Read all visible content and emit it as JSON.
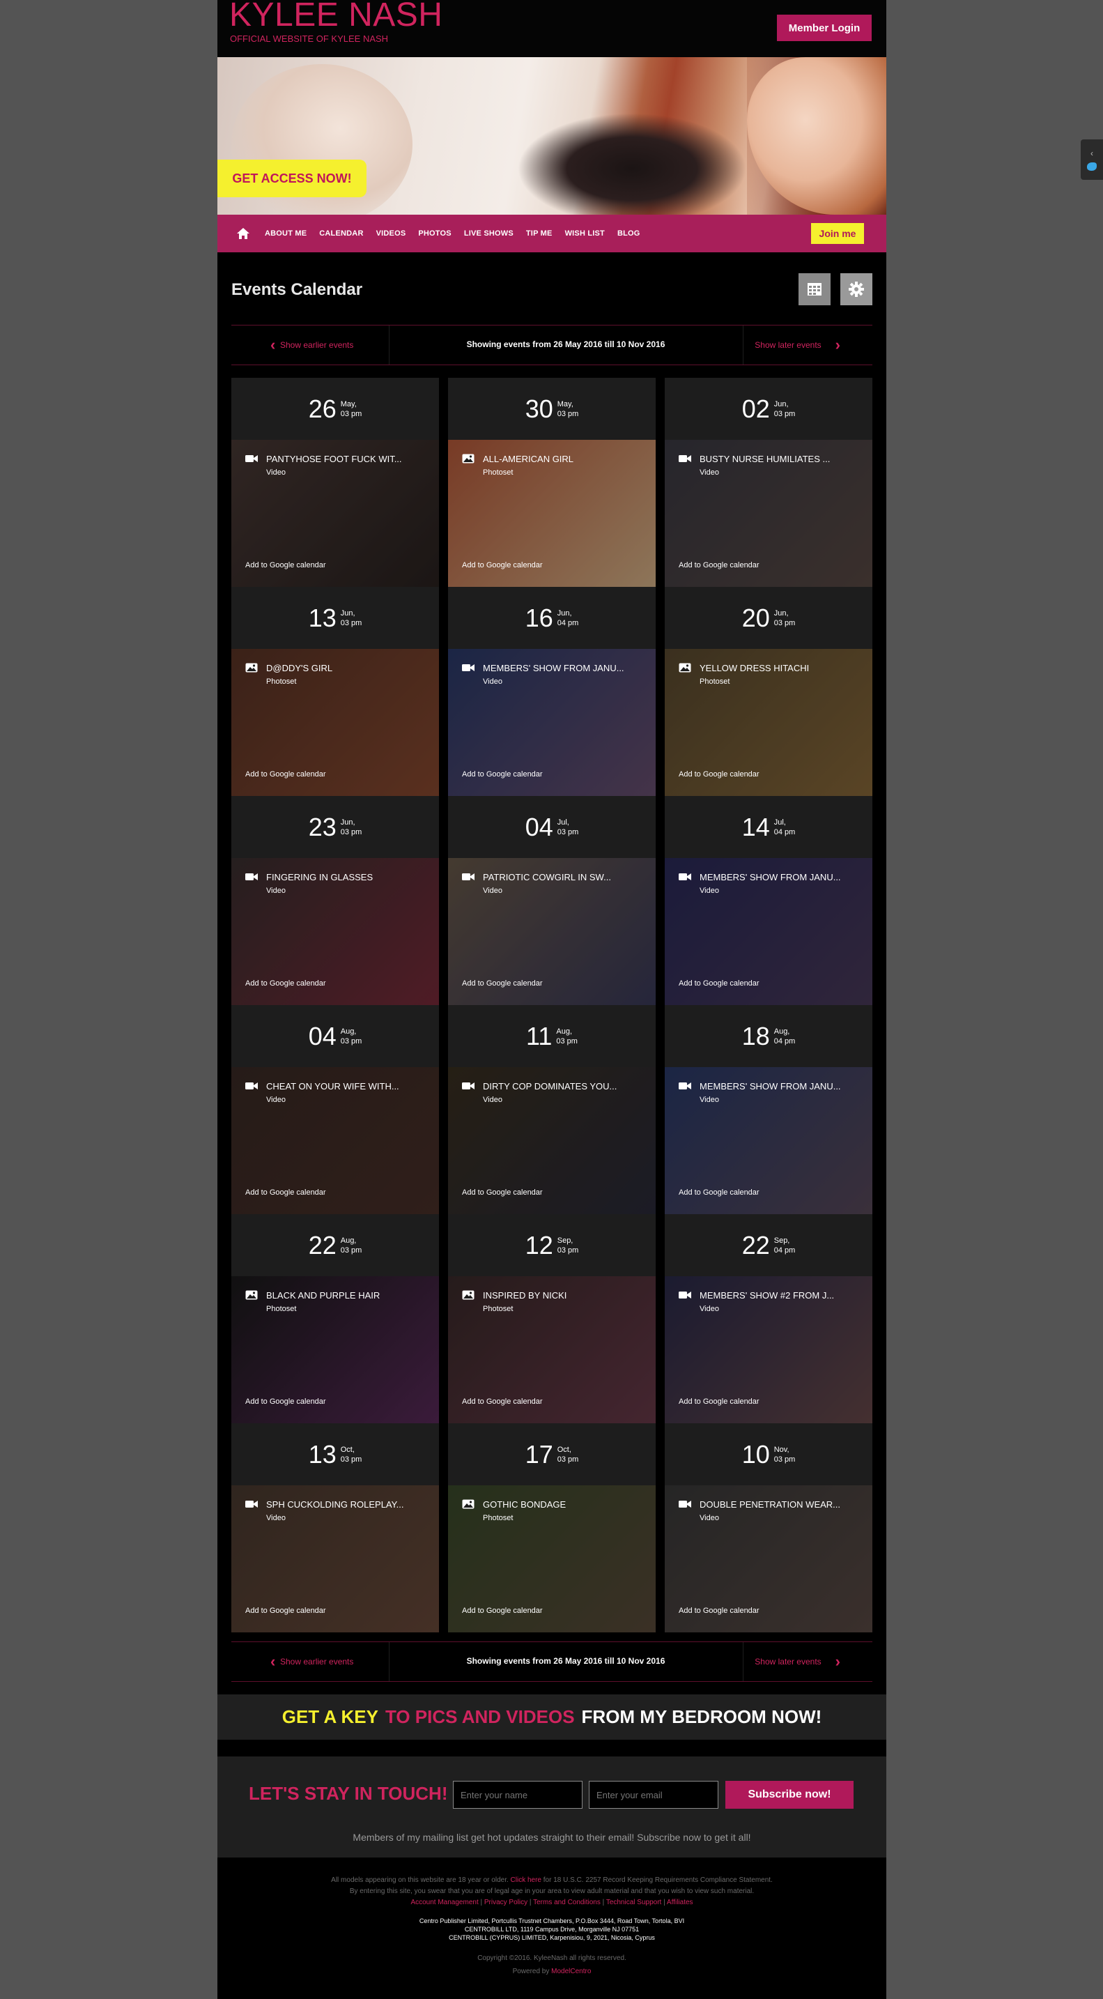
{
  "header": {
    "logo": "KYLEE NASH",
    "tagline": "OFFICIAL WEBSITE OF KYLEE NASH",
    "login_label": "Member Login"
  },
  "banner": {
    "cta_label": "GET ACCESS NOW!"
  },
  "nav": {
    "home_icon": "home-icon",
    "items": [
      "ABOUT ME",
      "CALENDAR",
      "VIDEOS",
      "PHOTOS",
      "LIVE SHOWS",
      "TIP ME",
      "WISH LIST",
      "BLOG"
    ],
    "join_label": "Join me"
  },
  "calendar": {
    "title": "Events Calendar",
    "view_icons": [
      "calendar-icon",
      "gear-icon"
    ],
    "prev_label": "Show earlier events",
    "next_label": "Show later events",
    "range_text": "Showing events from 26 May 2016 till 10 Nov 2016",
    "gcal_label": "Add to Google calendar",
    "events": [
      {
        "day": "26",
        "month": "May,",
        "time": "03 pm",
        "title": "PANTYHOSE FOOT FUCK WIT...",
        "kind": "Video",
        "icon": "video-icon",
        "colors": [
          "#4a3a36",
          "#2a2220"
        ]
      },
      {
        "day": "30",
        "month": "May,",
        "time": "03 pm",
        "title": "ALL-AMERICAN GIRL",
        "kind": "Photoset",
        "icon": "image-icon",
        "colors": [
          "#b85a3a",
          "#d9b58a"
        ]
      },
      {
        "day": "02",
        "month": "Jun,",
        "time": "03 pm",
        "title": "BUSTY NURSE HUMILIATES ...",
        "kind": "Video",
        "icon": "video-icon",
        "colors": [
          "#3b3a44",
          "#5a4a44"
        ]
      },
      {
        "day": "13",
        "month": "Jun,",
        "time": "03 pm",
        "title": "D@DDY'S GIRL",
        "kind": "Photoset",
        "icon": "image-icon",
        "colors": [
          "#5a3426",
          "#8a4a30"
        ]
      },
      {
        "day": "16",
        "month": "Jun,",
        "time": "04 pm",
        "title": "MEMBERS' SHOW FROM JANU...",
        "kind": "Video",
        "icon": "video-icon",
        "colors": [
          "#2a3a6a",
          "#6a5070"
        ]
      },
      {
        "day": "20",
        "month": "Jun,",
        "time": "03 pm",
        "title": "YELLOW DRESS HITACHI",
        "kind": "Photoset",
        "icon": "image-icon",
        "colors": [
          "#5a4a30",
          "#8a6a3a"
        ]
      },
      {
        "day": "23",
        "month": "Jun,",
        "time": "03 pm",
        "title": "FINGERING IN GLASSES",
        "kind": "Video",
        "icon": "video-icon",
        "colors": [
          "#3a3030",
          "#7a2a3a"
        ]
      },
      {
        "day": "04",
        "month": "Jul,",
        "time": "03 pm",
        "title": "PATRIOTIC COWGIRL IN SW...",
        "kind": "Video",
        "icon": "video-icon",
        "colors": [
          "#6a5a4a",
          "#3a3a5a"
        ]
      },
      {
        "day": "14",
        "month": "Jul,",
        "time": "04 pm",
        "title": "MEMBERS' SHOW FROM JANU...",
        "kind": "Video",
        "icon": "video-icon",
        "colors": [
          "#2a2a5a",
          "#4a3a5a"
        ]
      },
      {
        "day": "04",
        "month": "Aug,",
        "time": "03 pm",
        "title": "CHEAT ON YOUR WIFE WITH...",
        "kind": "Video",
        "icon": "video-icon",
        "colors": [
          "#3a2a26",
          "#4a3028"
        ]
      },
      {
        "day": "11",
        "month": "Aug,",
        "time": "03 pm",
        "title": "DIRTY COP DOMINATES YOU...",
        "kind": "Video",
        "icon": "video-icon",
        "colors": [
          "#3a3020",
          "#2a2a3a"
        ]
      },
      {
        "day": "18",
        "month": "Aug,",
        "time": "04 pm",
        "title": "MEMBERS' SHOW FROM JANU...",
        "kind": "Video",
        "icon": "video-icon",
        "colors": [
          "#2a3a6a",
          "#5a4a5a"
        ]
      },
      {
        "day": "22",
        "month": "Aug,",
        "time": "03 pm",
        "title": "BLACK AND PURPLE HAIR",
        "kind": "Photoset",
        "icon": "image-icon",
        "colors": [
          "#1a1a1a",
          "#5a2a5a"
        ]
      },
      {
        "day": "12",
        "month": "Sep,",
        "time": "03 pm",
        "title": "INSPIRED BY NICKI",
        "kind": "Photoset",
        "icon": "image-icon",
        "colors": [
          "#3a2a2a",
          "#6a3a4a"
        ]
      },
      {
        "day": "22",
        "month": "Sep,",
        "time": "04 pm",
        "title": "MEMBERS' SHOW #2 FROM J...",
        "kind": "Video",
        "icon": "video-icon",
        "colors": [
          "#2a2a4a",
          "#6a4a4a"
        ]
      },
      {
        "day": "13",
        "month": "Oct,",
        "time": "03 pm",
        "title": "SPH CUCKOLDING ROLEPLAY...",
        "kind": "Video",
        "icon": "video-icon",
        "colors": [
          "#4a3a30",
          "#6a4a3a"
        ]
      },
      {
        "day": "17",
        "month": "Oct,",
        "time": "03 pm",
        "title": "GOTHIC BONDAGE",
        "kind": "Photoset",
        "icon": "image-icon",
        "colors": [
          "#3a4a2a",
          "#5a4a3a"
        ]
      },
      {
        "day": "10",
        "month": "Nov,",
        "time": "03 pm",
        "title": "DOUBLE PENETRATION WEAR...",
        "kind": "Video",
        "icon": "video-icon",
        "colors": [
          "#3a3a3a",
          "#5a4a44"
        ]
      }
    ]
  },
  "promo": {
    "part1": "GET A KEY",
    "part2": "TO PICS AND VIDEOS",
    "part3": "FROM MY BEDROOM NOW!"
  },
  "newsletter": {
    "title": "LET'S STAY IN TOUCH!",
    "name_placeholder": "Enter your name",
    "email_placeholder": "Enter your email",
    "subscribe_label": "Subscribe now!",
    "note": "Members of my mailing list get hot updates straight to their email! Subscribe now to get it all!"
  },
  "footer": {
    "line1_a": "All models appearing on this website are 18 year or older.",
    "line1_link": "Click here",
    "line1_b": "for 18 U.S.C. 2257 Record Keeping Requirements Compliance Statement.",
    "line2": "By entering this site, you swear that you are of legal age in your area to view adult material and that you wish to view such material.",
    "links": [
      "Account Management",
      "Privacy Policy",
      "Terms and Conditions",
      "Technical Support",
      "Affiliates"
    ],
    "addr1": "Centro Publisher Limited, Portcullis Trustnet Chambers, P.O.Box 3444, Road Town, Tortola, BVI",
    "addr2": "CENTROBILL LTD, 1119 Campus Drive, Morganville NJ 07751",
    "addr3": "CENTROBILL (CYPRUS) LIMITED, Karpenisiou, 9, 2021, Nicosia, Cyprus",
    "copyright": "Copyright ©2016. KyleeNash all rights reserved.",
    "powered_prefix": "Powered by",
    "powered_link": "ModelCentro"
  },
  "colors": {
    "accent": "#d0245e",
    "nav_bg": "#a81f5a",
    "cta_yellow": "#f5f02e"
  }
}
